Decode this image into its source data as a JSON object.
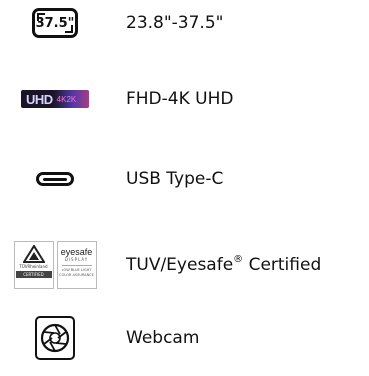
{
  "features": [
    {
      "icon": "screen-size-icon",
      "icon_text": "37.5\"",
      "label": "23.8\"-37.5\""
    },
    {
      "icon": "uhd-logo-icon",
      "icon_text": "UHD",
      "icon_sub": "4K2K",
      "label": "FHD-4K UHD"
    },
    {
      "icon": "usb-c-port-icon",
      "label": "USB Type-C"
    },
    {
      "icon": "tuv-eyesafe-certification-icon",
      "label_main": "TUV/Eyesafe",
      "label_reg": "®",
      "label_tail": " Certified",
      "tuv_name": "TÜVRheinland",
      "tuv_band": "CERTIFIED",
      "eyesafe_name": "eyesafe",
      "eyesafe_sub": "DISPLAY",
      "eyesafe_small": "LOW BLUE LIGHT COLOR ASSURANCE"
    },
    {
      "icon": "webcam-shutter-icon",
      "label": "Webcam"
    }
  ]
}
